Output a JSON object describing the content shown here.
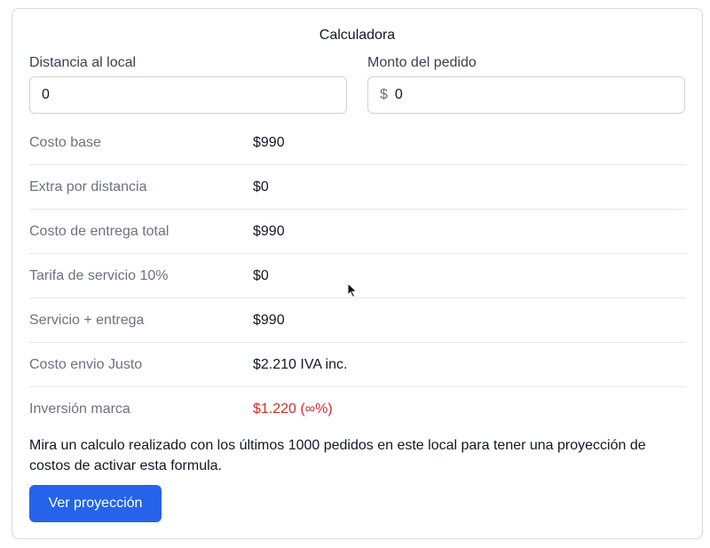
{
  "calculator": {
    "title": "Calculadora",
    "distance": {
      "label": "Distancia al local",
      "value": "0"
    },
    "amount": {
      "label": "Monto del pedido",
      "currency_symbol": "$",
      "value": "0"
    },
    "rows": [
      {
        "label": "Costo base",
        "value": "$990"
      },
      {
        "label": "Extra por distancia",
        "value": "$0"
      },
      {
        "label": "Costo de entrega total",
        "value": "$990"
      },
      {
        "label": "Tarifa de servicio 10%",
        "value": "$0"
      },
      {
        "label": "Servicio + entrega",
        "value": "$990"
      },
      {
        "label": "Costo envio Justo",
        "value": "$2.210 IVA inc."
      },
      {
        "label": "Inversión marca",
        "value": "$1.220 (∞%)"
      }
    ],
    "description": "Mira un calculo realizado con los últimos 1000 pedidos en este local para tener una proyección de costos de activar esta formula.",
    "button_label": "Ver proyección"
  },
  "colors": {
    "accent": "#2563eb",
    "negative": "#d12d2d",
    "muted_label": "#6b7280"
  }
}
